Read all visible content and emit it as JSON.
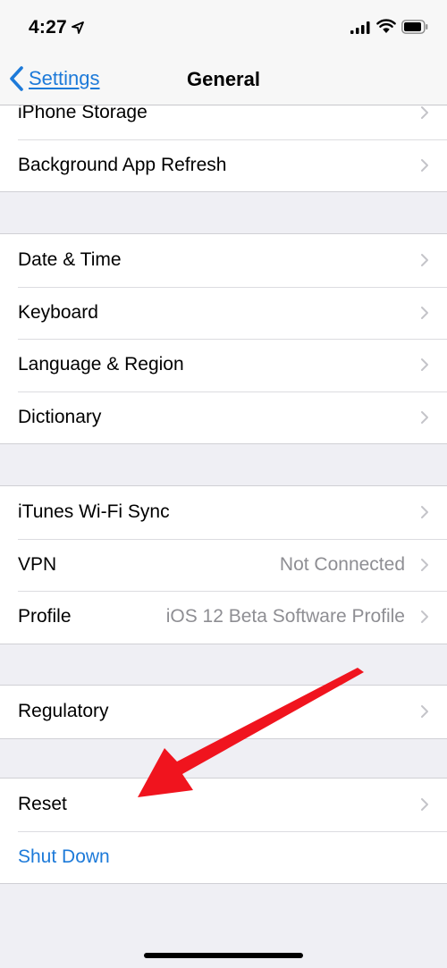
{
  "status_bar": {
    "time": "4:27"
  },
  "nav": {
    "back_label": "Settings",
    "title": "General"
  },
  "groups": [
    {
      "rows": [
        {
          "label": "iPhone Storage",
          "detail": ""
        },
        {
          "label": "Background App Refresh",
          "detail": ""
        }
      ]
    },
    {
      "rows": [
        {
          "label": "Date & Time",
          "detail": ""
        },
        {
          "label": "Keyboard",
          "detail": ""
        },
        {
          "label": "Language & Region",
          "detail": ""
        },
        {
          "label": "Dictionary",
          "detail": ""
        }
      ]
    },
    {
      "rows": [
        {
          "label": "iTunes Wi-Fi Sync",
          "detail": ""
        },
        {
          "label": "VPN",
          "detail": "Not Connected"
        },
        {
          "label": "Profile",
          "detail": "iOS 12 Beta Software Profile"
        }
      ]
    },
    {
      "rows": [
        {
          "label": "Regulatory",
          "detail": ""
        }
      ]
    },
    {
      "rows": [
        {
          "label": "Reset",
          "detail": ""
        },
        {
          "label": "Shut Down",
          "detail": ""
        }
      ]
    }
  ],
  "colors": {
    "accent": "#1d7ad9",
    "annotation_arrow": "#f0141e",
    "background": "#efeff4"
  }
}
